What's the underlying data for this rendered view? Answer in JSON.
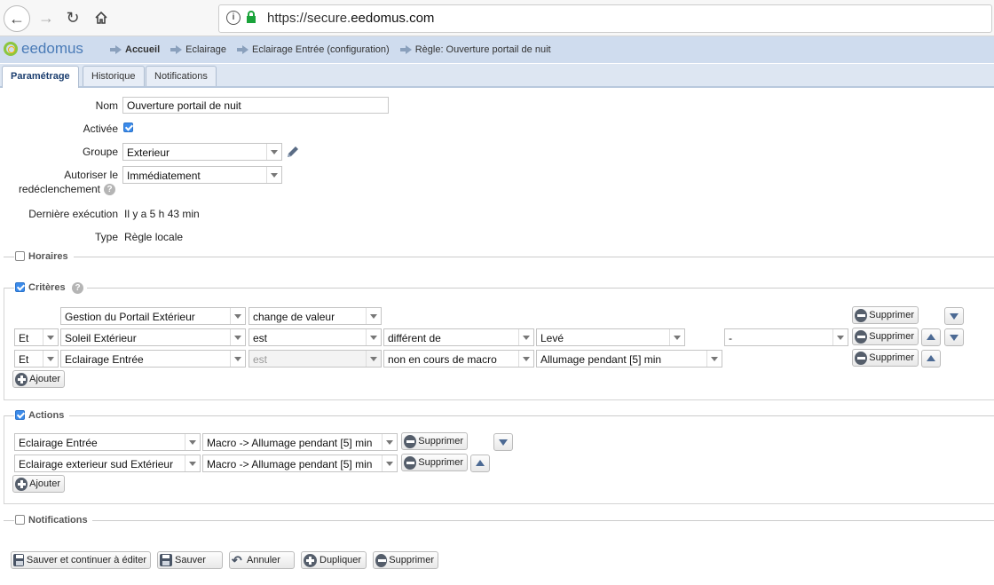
{
  "browser": {
    "url_prefix": "https://secure.",
    "url_host": "eedomus.com"
  },
  "app": {
    "logo_text": "eedomus"
  },
  "breadcrumb": [
    "Accueil",
    "Eclairage",
    "Eclairage Entrée (configuration)",
    "Règle: Ouverture portail de nuit"
  ],
  "tabs": [
    "Paramétrage",
    "Historique",
    "Notifications"
  ],
  "form": {
    "nom_label": "Nom",
    "nom_value": "Ouverture portail de nuit",
    "activee_label": "Activée",
    "groupe_label": "Groupe",
    "groupe_value": "Exterieur",
    "autoriser_label_1": "Autoriser le",
    "autoriser_label_2": "redéclenchement",
    "autoriser_value": "Immédiatement",
    "derniere_label": "Dernière exécution",
    "derniere_value": "Il y a 5 h 43 min",
    "type_label": "Type",
    "type_value": "Règle locale"
  },
  "sections": {
    "horaires": "Horaires",
    "criteres": "Critères",
    "actions": "Actions",
    "notifications": "Notifications"
  },
  "criteria": [
    {
      "op": "",
      "device": "Gestion du Portail Extérieur",
      "cond": "change de valeur",
      "comp": "",
      "value": "",
      "extra": ""
    },
    {
      "op": "Et",
      "device": "Soleil Extérieur",
      "cond": "est",
      "comp": "différent de",
      "value": "Levé",
      "extra": "-"
    },
    {
      "op": "Et",
      "device": "Eclairage Entrée",
      "cond": "est",
      "comp": "non en cours de macro",
      "value": "Allumage pendant [5] min",
      "extra": ""
    }
  ],
  "actions": [
    {
      "device": "Eclairage Entrée",
      "action": "Macro -> Allumage pendant [5] min"
    },
    {
      "device": "Eclairage exterieur sud Extérieur",
      "action": "Macro -> Allumage pendant [5] min"
    }
  ],
  "labels": {
    "supprimer": "Supprimer",
    "ajouter": "Ajouter"
  },
  "footer": {
    "save_continue": "Sauver et continuer à éditer",
    "save": "Sauver",
    "cancel": "Annuler",
    "duplicate": "Dupliquer",
    "delete": "Supprimer"
  }
}
